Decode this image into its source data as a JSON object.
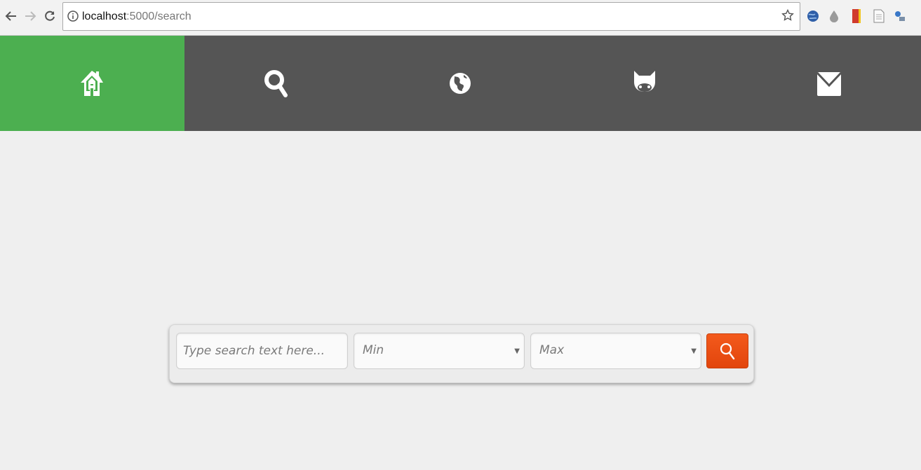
{
  "browser": {
    "url_host": "localhost",
    "url_path": ":5000/search"
  },
  "nav": {
    "items": [
      {
        "icon": "home-icon",
        "active": true
      },
      {
        "icon": "search-icon",
        "active": false
      },
      {
        "icon": "globe-icon",
        "active": false
      },
      {
        "icon": "github-icon",
        "active": false
      },
      {
        "icon": "envelope-icon",
        "active": false
      }
    ],
    "active_color": "#4caf50",
    "bar_color": "#555555"
  },
  "search": {
    "placeholder": "Type search text here...",
    "min_selected": "Min",
    "max_selected": "Max",
    "button_color": "#e8490f"
  }
}
